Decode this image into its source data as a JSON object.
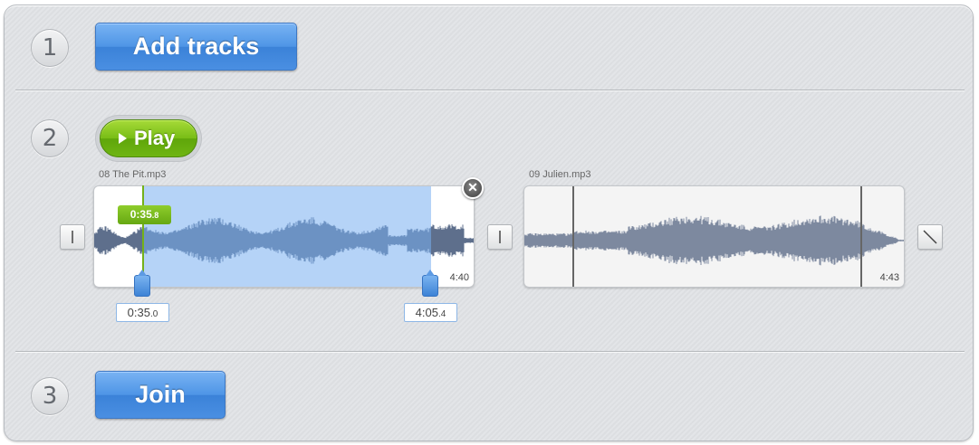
{
  "steps": {
    "step1": {
      "number": "1",
      "button_label": "Add tracks"
    },
    "step2": {
      "number": "2",
      "play_label": "Play"
    },
    "step3": {
      "number": "3",
      "button_label": "Join"
    }
  },
  "tracks": [
    {
      "filename": "08 The Pit.mp3",
      "duration": "4:40",
      "cursor_time_main": "0:35",
      "cursor_time_frac": ".8",
      "start_time_main": "0:35",
      "start_time_frac": ".0",
      "end_time_main": "4:05",
      "end_time_frac": ".4",
      "selection_start_fraction": 0.13,
      "selection_end_fraction": 0.88
    },
    {
      "filename": "09 Julien.mp3",
      "duration": "4:43"
    }
  ],
  "icons": {
    "close": "close-icon",
    "fade_in": "fade-in-icon",
    "crossfade": "crossfade-icon",
    "fade_out": "fade-out-icon"
  },
  "colors": {
    "accent_blue": "#4a8fe2",
    "play_green": "#78bd16",
    "selection": "#a9cdf5",
    "waveform": "#5e6f8c"
  }
}
